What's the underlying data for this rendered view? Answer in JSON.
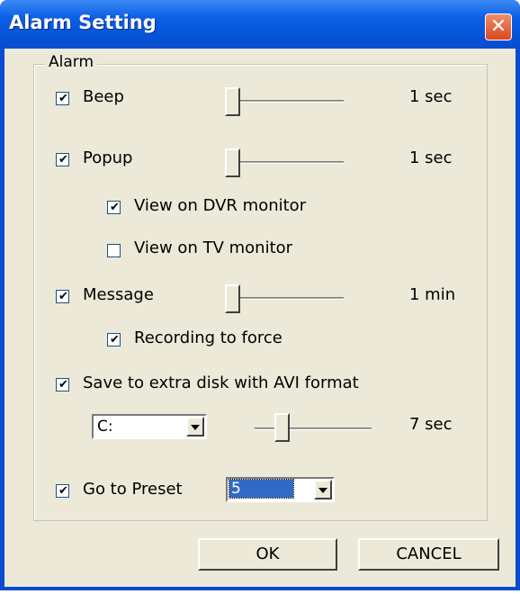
{
  "window": {
    "title": "Alarm Setting",
    "close_icon": "close-icon"
  },
  "group": {
    "title": "Alarm"
  },
  "options": {
    "beep": {
      "label": "Beep",
      "checked": true,
      "value": "1 sec"
    },
    "popup": {
      "label": "Popup",
      "checked": true,
      "value": "1 sec"
    },
    "view_dvr": {
      "label": "View on DVR monitor",
      "checked": true
    },
    "view_tv": {
      "label": "View on TV monitor",
      "checked": false
    },
    "message": {
      "label": "Message",
      "checked": true,
      "value": "1 min"
    },
    "recording": {
      "label": "Recording to force",
      "checked": true
    },
    "save_avi": {
      "label": "Save to extra disk with AVI format",
      "checked": true,
      "drive": "C:",
      "value": "7 sec"
    },
    "preset": {
      "label": "Go to Preset",
      "checked": true,
      "selected": "5"
    }
  },
  "buttons": {
    "ok": "OK",
    "cancel": "CANCEL"
  }
}
